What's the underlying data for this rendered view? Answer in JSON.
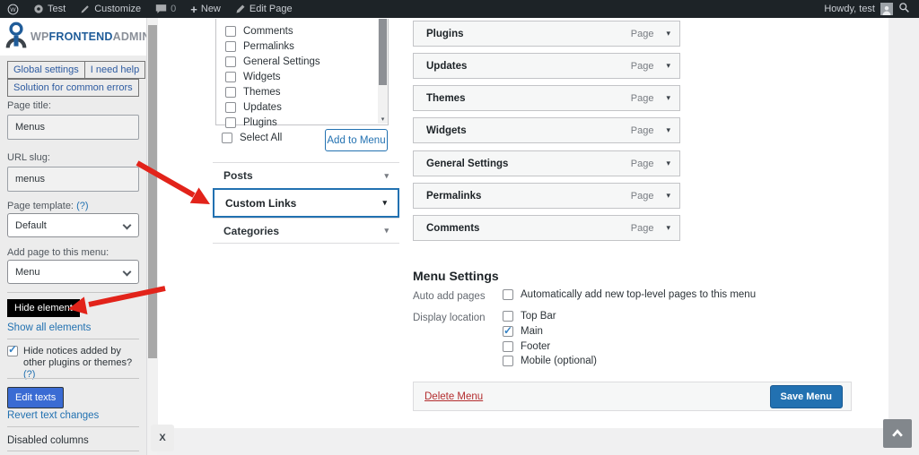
{
  "admin_bar": {
    "site_name": "Test",
    "customize_label": "Customize",
    "comment_count": "0",
    "new_label": "New",
    "edit_page_label": "Edit Page",
    "howdy": "Howdy, test"
  },
  "sidebar": {
    "logo": {
      "wp": "WP",
      "frontend": "FRONTEND",
      "admin": "ADMIN"
    },
    "buttons": {
      "global_settings": "Global settings",
      "need_help": "I need help",
      "solution": "Solution for common errors"
    },
    "page_title_label": "Page title:",
    "page_title_value": "Menus",
    "url_slug_label": "URL slug:",
    "url_slug_value": "menus",
    "page_template_label": "Page template:",
    "help_mark": "(?)",
    "page_template_value": "Default",
    "add_page_label": "Add page to this menu:",
    "add_page_value": "Menu",
    "hide_element_label": "Hide element",
    "show_all_label": "Show all elements",
    "hide_notices_label": "Hide notices added by other plugins or themes?",
    "hide_notices_checked": true,
    "edit_texts_label": "Edit texts",
    "revert_label": "Revert text changes",
    "disabled_columns_label": "Disabled columns",
    "close_label": "X"
  },
  "menu_builder": {
    "pages_list": [
      "Comments",
      "Permalinks",
      "General Settings",
      "Widgets",
      "Themes",
      "Updates",
      "Plugins"
    ],
    "select_all_label": "Select All",
    "add_to_menu_label": "Add to Menu",
    "accordion_posts": "Posts",
    "accordion_custom_links": "Custom Links",
    "accordion_categories": "Categories",
    "highlighted_accordion": "Custom Links"
  },
  "menu_structure": {
    "items": [
      {
        "label": "Plugins",
        "type": "Page"
      },
      {
        "label": "Updates",
        "type": "Page"
      },
      {
        "label": "Themes",
        "type": "Page"
      },
      {
        "label": "Widgets",
        "type": "Page"
      },
      {
        "label": "General Settings",
        "type": "Page"
      },
      {
        "label": "Permalinks",
        "type": "Page"
      },
      {
        "label": "Comments",
        "type": "Page"
      }
    ]
  },
  "menu_settings": {
    "title": "Menu Settings",
    "auto_add_label": "Auto add pages",
    "auto_add_option": "Automatically add new top-level pages to this menu",
    "auto_add_checked": false,
    "display_location_label": "Display location",
    "locations": [
      {
        "label": "Top Bar",
        "checked": false
      },
      {
        "label": "Main",
        "checked": true
      },
      {
        "label": "Footer",
        "checked": false
      },
      {
        "label": "Mobile (optional)",
        "checked": false
      }
    ],
    "delete_label": "Delete Menu",
    "save_label": "Save Menu"
  },
  "glyphs": {
    "chevron_down": "▾"
  },
  "colors": {
    "accent_blue": "#2271b1",
    "highlight_border": "#2271b1",
    "arrow_red": "#e2231a",
    "save_button_bg": "#2271b1",
    "edit_texts_button_bg": "#3a6bd3",
    "delete_link_red": "#b32d2e",
    "admin_bar_bg": "#1d2327",
    "hide_element_bg": "#000000",
    "checked_check": "#3582c4"
  }
}
